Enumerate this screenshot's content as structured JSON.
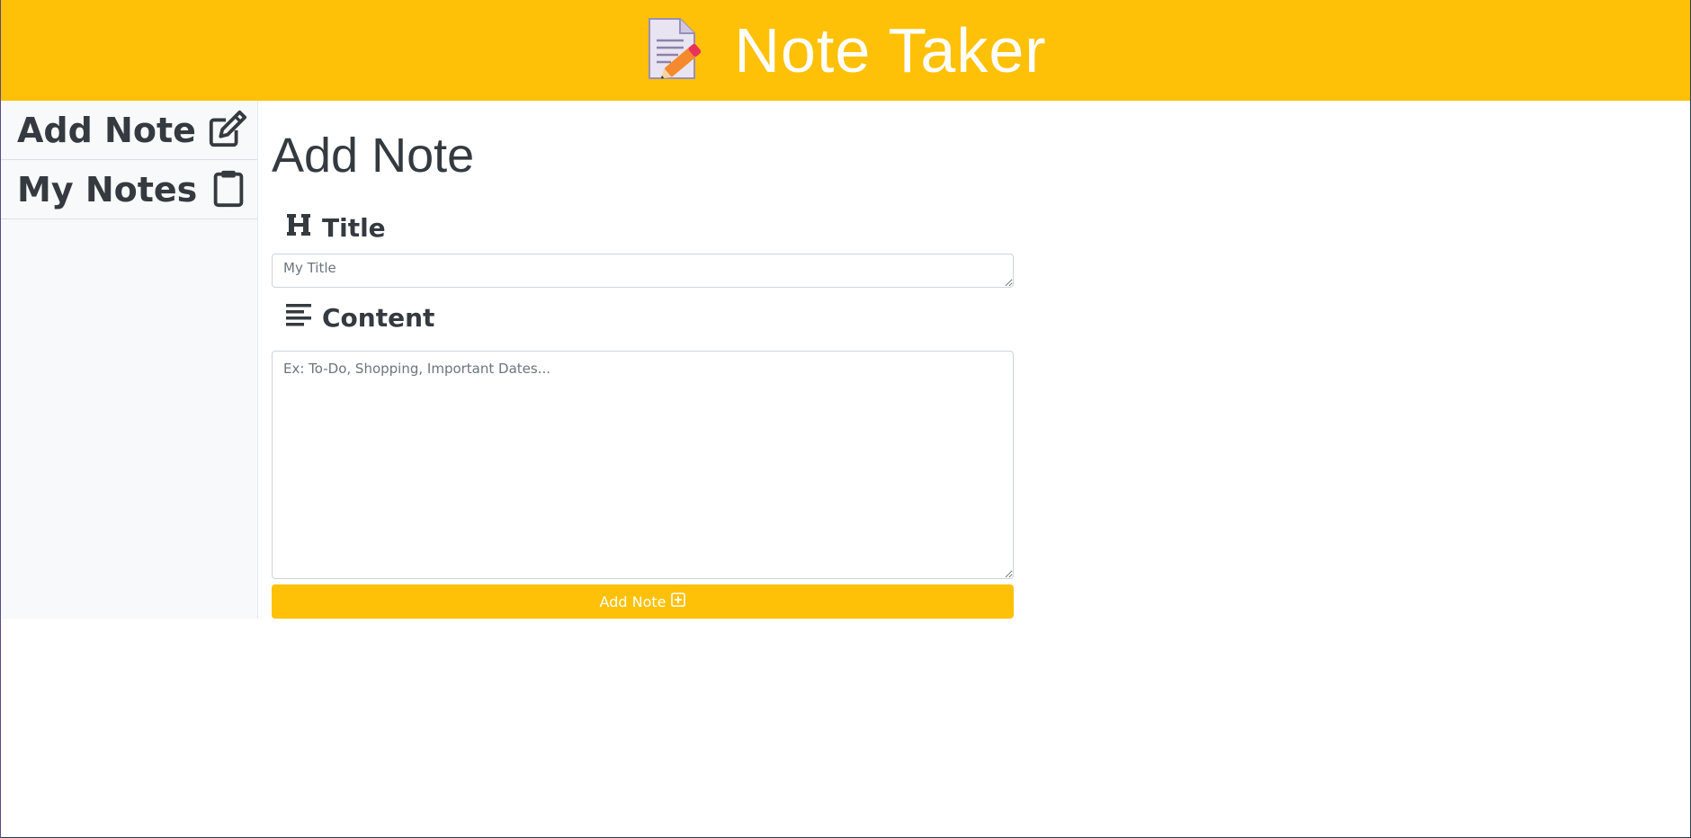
{
  "header": {
    "app_title": "Note Taker",
    "logo_icon": "memo-pencil-icon",
    "background_color": "#ffc107"
  },
  "sidebar": {
    "items": [
      {
        "label": "Add Note",
        "icon": "edit-icon"
      },
      {
        "label": "My Notes",
        "icon": "clipboard-icon"
      }
    ]
  },
  "main": {
    "page_title": "Add Note",
    "title_field": {
      "label": "Title",
      "icon": "heading-icon",
      "placeholder": "My Title",
      "value": ""
    },
    "content_field": {
      "label": "Content",
      "icon": "align-left-icon",
      "placeholder": "Ex: To-Do, Shopping, Important Dates...",
      "value": ""
    },
    "submit_button": {
      "label": "Add Note",
      "icon": "plus-square-icon",
      "color": "#ffc107"
    }
  }
}
